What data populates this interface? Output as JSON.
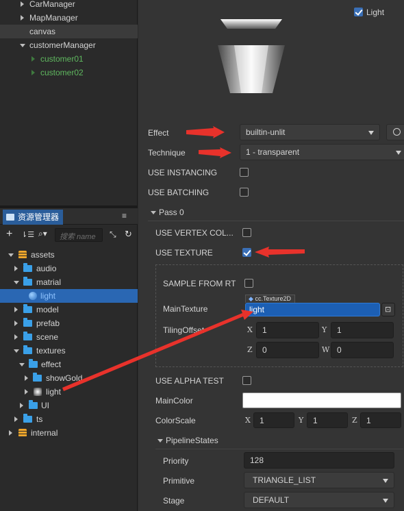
{
  "hierarchy": {
    "items": [
      {
        "label": "CarManager"
      },
      {
        "label": "MapManager"
      },
      {
        "label": "canvas"
      },
      {
        "label": "customerManager"
      },
      {
        "label": "customer01"
      },
      {
        "label": "customer02"
      }
    ]
  },
  "assets": {
    "tab_label": "资源管理器",
    "search_placeholder": "搜索 name",
    "tree": [
      {
        "label": "assets"
      },
      {
        "label": "audio"
      },
      {
        "label": "matrial"
      },
      {
        "label": "light"
      },
      {
        "label": "model"
      },
      {
        "label": "prefab"
      },
      {
        "label": "scene"
      },
      {
        "label": "textures"
      },
      {
        "label": "effect"
      },
      {
        "label": "showGold"
      },
      {
        "label": "light"
      },
      {
        "label": "UI"
      },
      {
        "label": "ts"
      },
      {
        "label": "internal"
      }
    ]
  },
  "inspector": {
    "light_label": "Light",
    "light_checked": true,
    "effect": {
      "label": "Effect",
      "value": "builtin-unlit"
    },
    "technique": {
      "label": "Technique",
      "value": "1 - transparent"
    },
    "use_instancing": {
      "label": "USE INSTANCING",
      "checked": false
    },
    "use_batching": {
      "label": "USE BATCHING",
      "checked": false
    },
    "pass_label": "Pass 0",
    "use_vertex_color": {
      "label": "USE VERTEX COL...",
      "checked": false
    },
    "use_texture": {
      "label": "USE TEXTURE",
      "checked": true
    },
    "sample_from_rt": {
      "label": "SAMPLE FROM RT",
      "checked": false
    },
    "main_texture": {
      "label": "MainTexture",
      "type_tag": "cc.Texture2D",
      "value": "light"
    },
    "tiling_offset": {
      "label": "TilingOffset",
      "x": "1",
      "y": "1",
      "z": "0",
      "w": "0"
    },
    "use_alpha_test": {
      "label": "USE ALPHA TEST",
      "checked": false
    },
    "main_color": {
      "label": "MainColor",
      "color": "#ffffff"
    },
    "color_scale": {
      "label": "ColorScale",
      "x": "1",
      "y": "1",
      "z": "1"
    },
    "pipeline_states_label": "PipelineStates",
    "priority": {
      "label": "Priority",
      "value": "128"
    },
    "primitive": {
      "label": "Primitive",
      "value": "TRIANGLE_LIST"
    },
    "stage": {
      "label": "Stage",
      "value": "DEFAULT"
    },
    "axis": {
      "x": "X",
      "y": "Y",
      "z": "Z",
      "w": "W"
    }
  },
  "colors": {
    "accent": "#2a67b3",
    "annotation_arrow": "#e8322b",
    "folder": "#3aa0e8"
  }
}
